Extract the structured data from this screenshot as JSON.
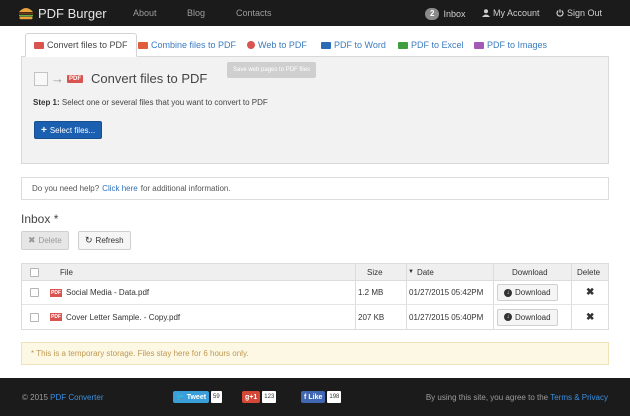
{
  "navbar": {
    "brand": "PDF Burger",
    "links": [
      "About",
      "Blog",
      "Contacts"
    ],
    "inbox_count": "2",
    "inbox_label": "Inbox",
    "account_label": "My Account",
    "signout_label": "Sign Out"
  },
  "tabs": [
    {
      "label": "Convert files to PDF",
      "icon": "pdf-icon",
      "color": "#d9534f"
    },
    {
      "label": "Combine files to PDF",
      "icon": "combine-icon",
      "color": "#e05c3a"
    },
    {
      "label": "Web to PDF",
      "icon": "globe-icon",
      "color": "#d9534f"
    },
    {
      "label": "PDF to Word",
      "icon": "word-icon",
      "color": "#2b6cb5"
    },
    {
      "label": "PDF to Excel",
      "icon": "excel-icon",
      "color": "#3f9e3f"
    },
    {
      "label": "PDF to Images",
      "icon": "images-icon",
      "color": "#a25ab5"
    }
  ],
  "converter": {
    "title": "Convert files to PDF",
    "pdf_badge": "PDF",
    "tooltip": "Save web pages to PDF files",
    "step_label": "Step 1:",
    "step_text": "Select one or several files that you want to convert to PDF",
    "select_button": "Select files..."
  },
  "help": {
    "prefix": "Do you need help?",
    "link": "Click here",
    "suffix": "for additional information."
  },
  "inbox": {
    "title": "Inbox *",
    "delete_label": "Delete",
    "refresh_label": "Refresh"
  },
  "table": {
    "headers": {
      "file": "File",
      "size": "Size",
      "date": "Date",
      "download": "Download",
      "delete": "Delete"
    },
    "rows": [
      {
        "name": "Social Media - Data.pdf",
        "size": "1.2 MB",
        "date": "01/27/2015  05:42PM",
        "action": "Download"
      },
      {
        "name": "Cover Letter Sample. - Copy.pdf",
        "size": "207 KB",
        "date": "01/27/2015  05:40PM",
        "action": "Download"
      }
    ]
  },
  "notice": "* This is a temporary storage. Files stay here for 6 hours only.",
  "footer": {
    "copyright": "© 2015",
    "brand_link": "PDF Converter",
    "tweet_label": "Tweet",
    "tweet_count": "59",
    "gplus_label": "g+1",
    "gplus_count": "123",
    "like_label": "Like",
    "like_count": "198",
    "terms_prefix": "By using this site, you agree to the",
    "terms_link": "Terms & Privacy"
  },
  "colors": {
    "navbar": "#1b1b1b",
    "primary": "#1a5fb0",
    "link": "#2d6fb6",
    "pdf_red": "#d9534f",
    "notice_bg": "#fcf8e3"
  }
}
